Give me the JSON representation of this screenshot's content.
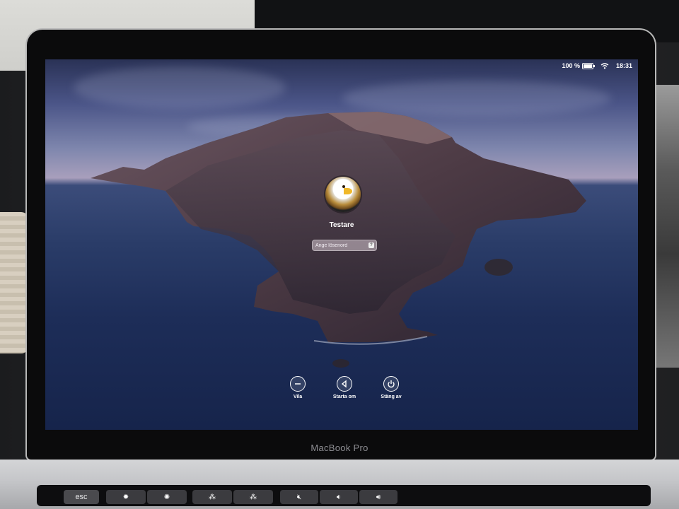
{
  "device": {
    "brand_label": "MacBook Pro"
  },
  "status_bar": {
    "battery": "100 %",
    "time": "18:31",
    "wifi_icon": "wifi-icon",
    "battery_icon": "battery-icon"
  },
  "login": {
    "user_name": "Testare",
    "password_placeholder": "Ange lösenord",
    "hint_icon": "?",
    "avatar_icon": "eagle-avatar-icon"
  },
  "actions": [
    {
      "label": "Vila",
      "icon": "sleep-icon"
    },
    {
      "label": "Starta om",
      "icon": "restart-icon"
    },
    {
      "label": "Stäng av",
      "icon": "power-icon"
    }
  ],
  "touch_bar": {
    "esc_label": "esc",
    "keys": [
      "brightness-down-icon",
      "brightness-up-icon",
      "keyboard-dim-icon",
      "keyboard-bright-icon",
      "mute-icon",
      "volume-down-icon",
      "volume-up-icon"
    ]
  }
}
